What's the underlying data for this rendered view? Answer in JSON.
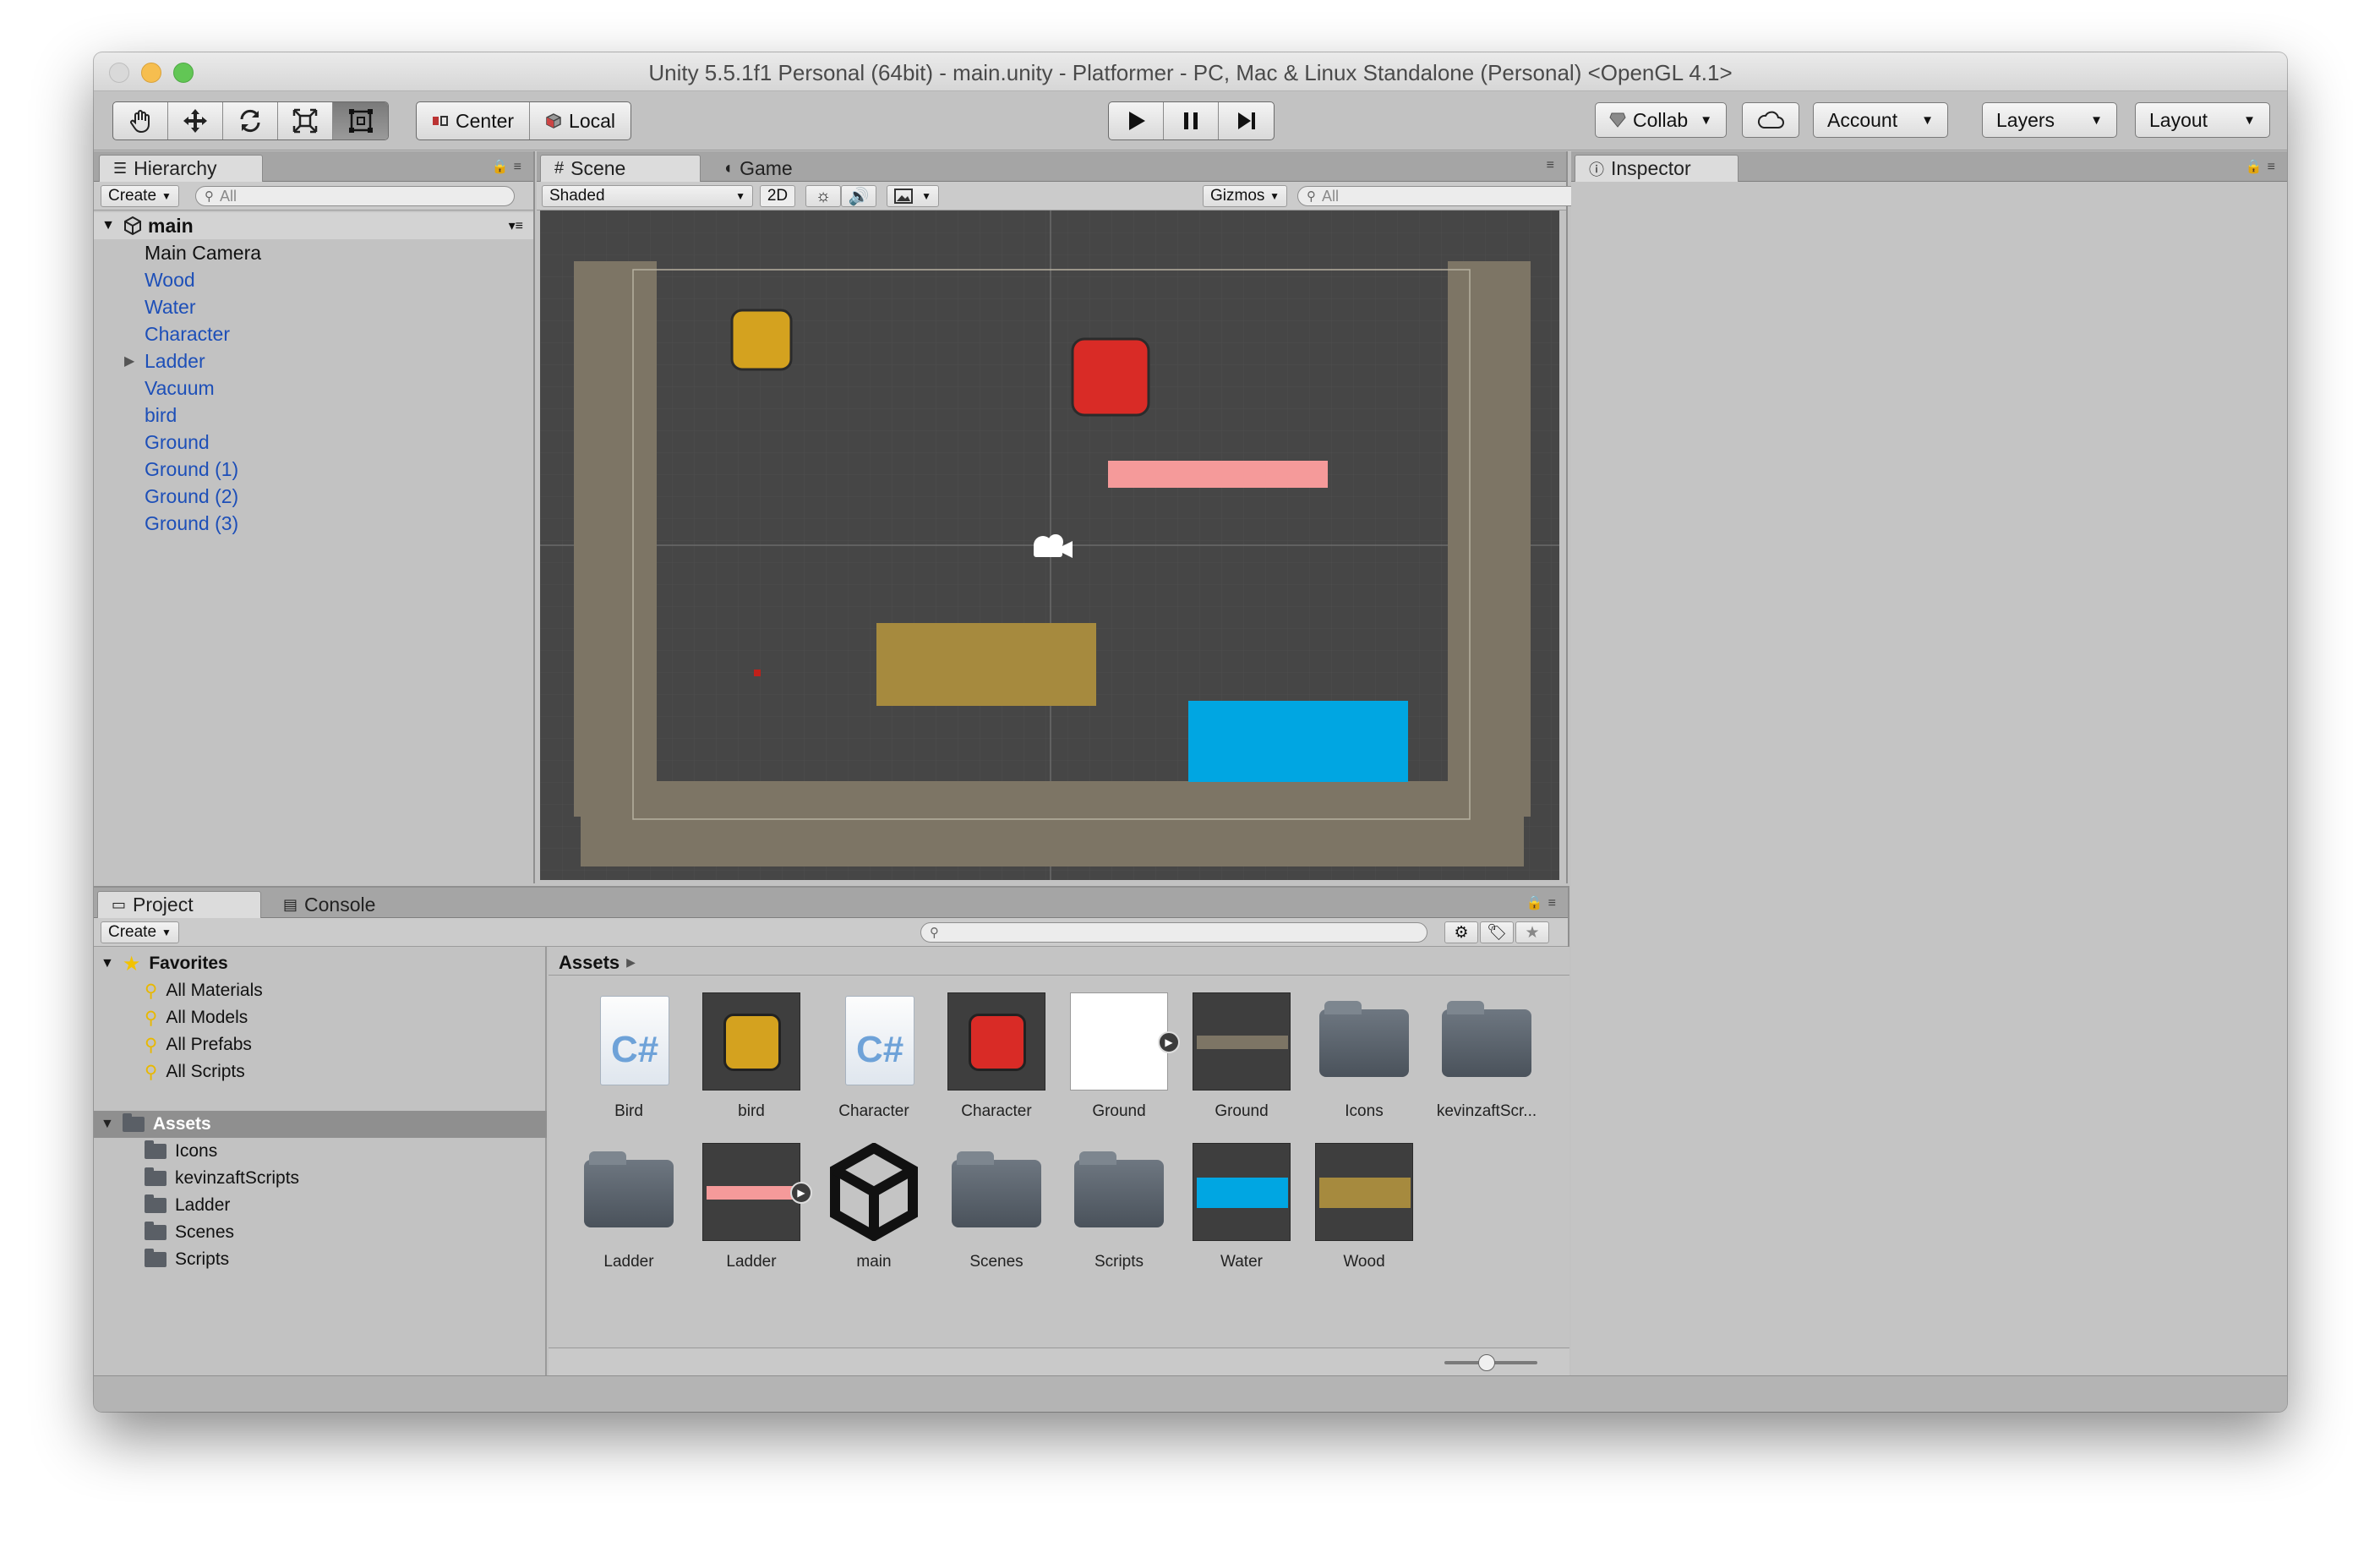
{
  "window": {
    "title": "Unity 5.5.1f1 Personal (64bit) - main.unity - Platformer - PC, Mac & Linux Standalone (Personal) <OpenGL 4.1>"
  },
  "toolbar": {
    "pivot_center": "Center",
    "pivot_local": "Local",
    "collab": "Collab",
    "account": "Account",
    "layers": "Layers",
    "layout": "Layout"
  },
  "hierarchy": {
    "tab": "Hierarchy",
    "create": "Create",
    "search_placeholder": "All",
    "root": "main",
    "items": [
      {
        "label": "Main Camera"
      },
      {
        "label": "Wood"
      },
      {
        "label": "Water"
      },
      {
        "label": "Character"
      },
      {
        "label": "Ladder"
      },
      {
        "label": "Vacuum"
      },
      {
        "label": "bird"
      },
      {
        "label": "Ground"
      },
      {
        "label": "Ground (1)"
      },
      {
        "label": "Ground (2)"
      },
      {
        "label": "Ground (3)"
      }
    ]
  },
  "scene": {
    "tab_scene": "Scene",
    "tab_game": "Game",
    "shading": "Shaded",
    "mode_2d": "2D",
    "gizmos": "Gizmos",
    "search_placeholder": "All"
  },
  "inspector": {
    "tab": "Inspector"
  },
  "project": {
    "tab_project": "Project",
    "tab_console": "Console",
    "create": "Create",
    "favorites_label": "Favorites",
    "favorites": [
      "All Materials",
      "All Models",
      "All Prefabs",
      "All Scripts"
    ],
    "assets_label": "Assets",
    "asset_folders": [
      "Icons",
      "kevinzaftScripts",
      "Ladder",
      "Scenes",
      "Scripts"
    ],
    "breadcrumb": "Assets",
    "grid": [
      {
        "label": "Bird"
      },
      {
        "label": "bird"
      },
      {
        "label": "Character"
      },
      {
        "label": "Character"
      },
      {
        "label": "Ground"
      },
      {
        "label": "Ground"
      },
      {
        "label": "Icons"
      },
      {
        "label": "kevinzaftScr..."
      },
      {
        "label": "Ladder"
      },
      {
        "label": "Ladder"
      },
      {
        "label": "main"
      },
      {
        "label": "Scenes"
      },
      {
        "label": "Scripts"
      },
      {
        "label": "Water"
      },
      {
        "label": "Wood"
      }
    ]
  },
  "colors": {
    "bird": "#d4a21f",
    "character": "#d92b26",
    "ladder": "#f59a9a",
    "water": "#00a6e2",
    "wood": "#a68a3e",
    "ground": "#7d7565",
    "hierarchy_link": "#1d4fb8"
  }
}
